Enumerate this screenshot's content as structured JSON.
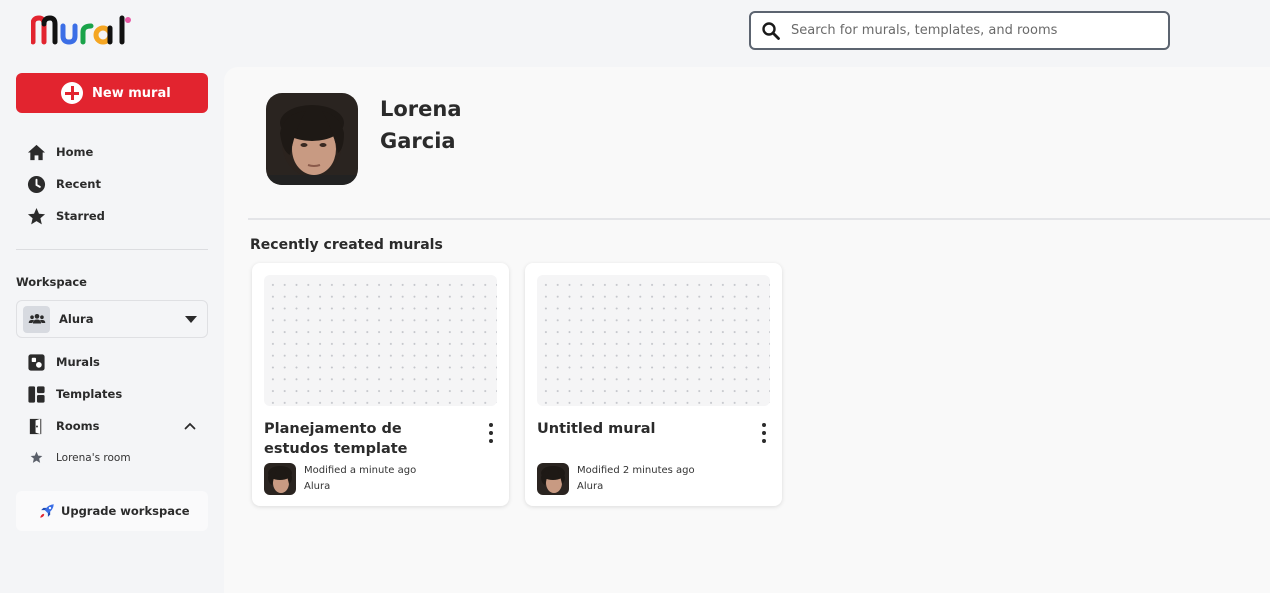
{
  "app": {
    "logo_text": "Mural"
  },
  "search": {
    "placeholder": "Search for murals, templates, and rooms",
    "value": ""
  },
  "sidebar": {
    "new_mural_label": "New mural",
    "nav": [
      {
        "label": "Home",
        "icon": "home-icon"
      },
      {
        "label": "Recent",
        "icon": "clock-icon"
      },
      {
        "label": "Starred",
        "icon": "star-icon"
      }
    ],
    "workspace_label": "Workspace",
    "workspace": {
      "name": "Alura",
      "icon": "people-icon"
    },
    "workspace_nav": [
      {
        "label": "Murals",
        "icon": "mural-icon"
      },
      {
        "label": "Templates",
        "icon": "templates-icon"
      },
      {
        "label": "Rooms",
        "icon": "door-icon"
      }
    ],
    "rooms": [
      {
        "label": "Lorena's room",
        "icon": "star-icon"
      }
    ],
    "upgrade_label": "Upgrade workspace"
  },
  "profile": {
    "first_name": "Lorena",
    "last_name": "Garcia"
  },
  "recent": {
    "title": "Recently created murals",
    "cards": [
      {
        "title": "Planejamento de estudos template",
        "modified": "Modified a minute ago",
        "workspace": "Alura"
      },
      {
        "title": "Untitled mural",
        "modified": "Modified 2 minutes ago",
        "workspace": "Alura"
      }
    ]
  },
  "colors": {
    "accent": "#e2242f",
    "background": "#f4f5f7",
    "text": "#2b2b2b"
  }
}
